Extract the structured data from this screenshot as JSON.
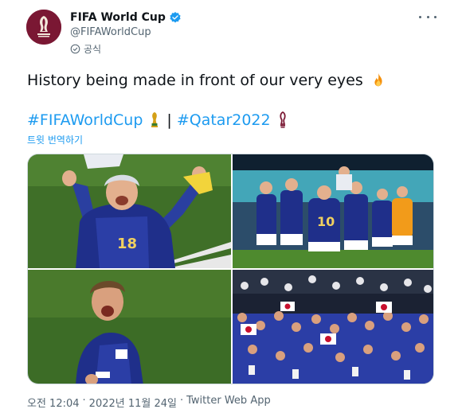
{
  "account": {
    "display_name": "FIFA World Cup",
    "handle": "@FIFAWorldCup",
    "official_label": "공식",
    "avatar_icon": "fifa-world-cup-logo",
    "avatar_color": "#7a1733",
    "verified_color": "#1d9bf0"
  },
  "tweet": {
    "text": "History being made in front of our very eyes",
    "text_emoji": "fire-icon",
    "hashtag1": "#FIFAWorldCup",
    "separator": "|",
    "hashtag2": "#Qatar2022",
    "translate": "트윗 번역하기"
  },
  "photos": [
    {
      "subject": "player celebrating with arms raised, jersey number",
      "jersey_number": "18"
    },
    {
      "subject": "team celebrating together on pitch, jersey number",
      "jersey_number": "10"
    },
    {
      "subject": "player shouting in celebration"
    },
    {
      "subject": "fans celebrating in stadium"
    }
  ],
  "meta": {
    "time": "오전 12:04",
    "dot1": "·",
    "date": "2022년 11월 24일",
    "dot2": "·",
    "source": "Twitter Web App"
  },
  "colors": {
    "link": "#1d9bf0",
    "secondary_text": "#536471",
    "pitch_green": "#4a7a2c",
    "japan_blue": "#1f2f8a"
  }
}
